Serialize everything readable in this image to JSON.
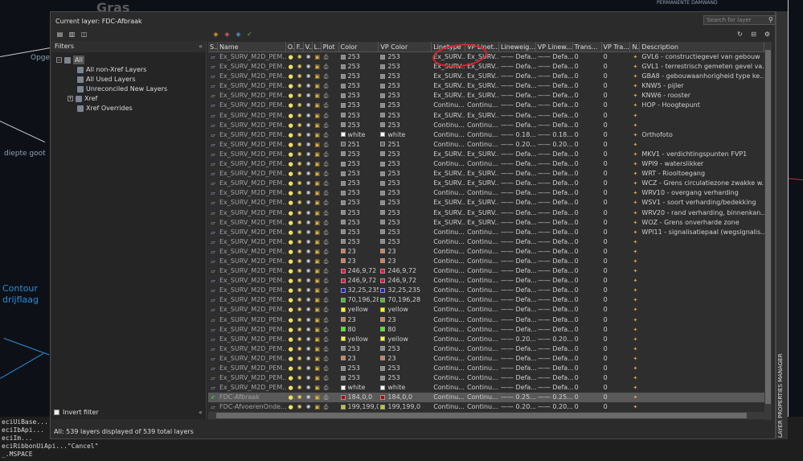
{
  "background": {
    "texts": [
      "Gras",
      "Opgel",
      "diepte goot",
      "Contour",
      "drijflaag",
      "PERMANENTE DAMWAND"
    ]
  },
  "command_line": {
    "lines": [
      "eciUiBase...",
      "eciIbApi...",
      "eciIm...",
      "eciRibbonUiApi...\"Cancel\"",
      "_.MSPACE"
    ]
  },
  "palette": {
    "current_layer": "Current layer: FDC-Afbraak",
    "search_placeholder": "Search for layer",
    "side_title": "LAYER PROPERTIES MANAGER",
    "filters_label": "Filters",
    "filters": [
      {
        "label": "All",
        "selected": true
      },
      {
        "label": "All non-Xref Layers"
      },
      {
        "label": "All Used Layers"
      },
      {
        "label": "Unreconciled New Layers"
      },
      {
        "label": "Xref"
      },
      {
        "label": "Xref Overrides"
      }
    ],
    "invert_filter": "Invert filter",
    "status": "All: 539 layers displayed of 539 total layers",
    "columns": [
      "S..",
      "Name",
      "O..",
      "F..",
      "V..",
      "L..",
      "Plot",
      "Color",
      "VP Color",
      "Linetype",
      "VP Linet...",
      "Lineweig...",
      "VP Linew...",
      "Trans...",
      "VP Tra...",
      "N..",
      "Description"
    ],
    "rows": [
      {
        "name": "Ex_SURV_M2D_PEM...",
        "color": "253",
        "sw": "#8a8a8a",
        "vp": "253",
        "vsw": "#8a8a8a",
        "lt": "Ex_SURV...",
        "vlt": "Ex_SURV...",
        "lw": "—— Defa...",
        "vlw": "—— Defa...",
        "tr": "0",
        "vtr": "0",
        "desc": "GVL6 - constructiegevel van gebouw"
      },
      {
        "name": "Ex_SURV_M2D_PEM...",
        "color": "253",
        "sw": "#8a8a8a",
        "vp": "253",
        "vsw": "#8a8a8a",
        "lt": "Ex_SURV...",
        "vlt": "Ex_SURV...",
        "lw": "—— Defa...",
        "vlw": "—— Defa...",
        "tr": "0",
        "vtr": "0",
        "desc": "GVL1 - terrestrisch gemeten gevel va..."
      },
      {
        "name": "Ex_SURV_M2D_PEM...",
        "color": "253",
        "sw": "#8a8a8a",
        "vp": "253",
        "vsw": "#8a8a8a",
        "lt": "Ex_SURV...",
        "vlt": "Ex_SURV...",
        "lw": "—— Defa...",
        "vlw": "—— Defa...",
        "tr": "0",
        "vtr": "0",
        "desc": "GBA8 - gebouwaanhorigheid type ke..."
      },
      {
        "name": "Ex_SURV_M2D_PEM...",
        "color": "253",
        "sw": "#8a8a8a",
        "vp": "253",
        "vsw": "#8a8a8a",
        "lt": "Ex_SURV...",
        "vlt": "Ex_SURV...",
        "lw": "—— Defa...",
        "vlw": "—— Defa...",
        "tr": "0",
        "vtr": "0",
        "desc": "KNW5 - pijler"
      },
      {
        "name": "Ex_SURV_M2D_PEM...",
        "color": "253",
        "sw": "#8a8a8a",
        "vp": "253",
        "vsw": "#8a8a8a",
        "lt": "Ex_SURV...",
        "vlt": "Ex_SURV...",
        "lw": "—— Defa...",
        "vlw": "—— Defa...",
        "tr": "0",
        "vtr": "0",
        "desc": "KNW6 - rooster"
      },
      {
        "name": "Ex_SURV_M2D_PEM...",
        "color": "253",
        "sw": "#8a8a8a",
        "vp": "253",
        "vsw": "#8a8a8a",
        "lt": "Continu...",
        "vlt": "Continu...",
        "lw": "—— Defa...",
        "vlw": "—— Defa...",
        "tr": "0",
        "vtr": "0",
        "desc": "HOP - Hoogtepunt"
      },
      {
        "name": "Ex_SURV_M2D_PEM...",
        "color": "253",
        "sw": "#8a8a8a",
        "vp": "253",
        "vsw": "#8a8a8a",
        "lt": "Ex_SURV...",
        "vlt": "Ex_SURV...",
        "lw": "—— Defa...",
        "vlw": "—— Defa...",
        "tr": "0",
        "vtr": "0",
        "desc": ""
      },
      {
        "name": "Ex_SURV_M2D_PEM...",
        "color": "253",
        "sw": "#8a8a8a",
        "vp": "253",
        "vsw": "#8a8a8a",
        "lt": "Continu...",
        "vlt": "Continu...",
        "lw": "—— Defa...",
        "vlw": "—— Defa...",
        "tr": "0",
        "vtr": "0",
        "desc": ""
      },
      {
        "name": "Ex_SURV_M2D_PEM...",
        "color": "white",
        "sw": "#ffffff",
        "vp": "white",
        "vsw": "#ffffff",
        "lt": "Continu...",
        "vlt": "Continu...",
        "lw": "—— 0.18...",
        "vlw": "—— 0.18...",
        "tr": "0",
        "vtr": "0",
        "desc": "Orthofoto"
      },
      {
        "name": "Ex_SURV_M2D_PEM...",
        "color": "251",
        "sw": "#5e5e5e",
        "vp": "251",
        "vsw": "#5e5e5e",
        "lt": "Continu...",
        "vlt": "Continu...",
        "lw": "—— 0.20...",
        "vlw": "—— 0.20...",
        "tr": "0",
        "vtr": "0",
        "desc": ""
      },
      {
        "name": "Ex_SURV_M2D_PEM...",
        "color": "253",
        "sw": "#8a8a8a",
        "vp": "253",
        "vsw": "#8a8a8a",
        "lt": "Ex_SURV...",
        "vlt": "Ex_SURV...",
        "lw": "—— Defa...",
        "vlw": "—— Defa...",
        "tr": "0",
        "vtr": "0",
        "desc": "MKV1 - verdichtingspunten FVP1"
      },
      {
        "name": "Ex_SURV_M2D_PEM...",
        "color": "253",
        "sw": "#8a8a8a",
        "vp": "253",
        "vsw": "#8a8a8a",
        "lt": "Continu...",
        "vlt": "Continu...",
        "lw": "—— Defa...",
        "vlw": "—— Defa...",
        "tr": "0",
        "vtr": "0",
        "desc": "WPI9 - waterslikker"
      },
      {
        "name": "Ex_SURV_M2D_PEM...",
        "color": "253",
        "sw": "#8a8a8a",
        "vp": "253",
        "vsw": "#8a8a8a",
        "lt": "Ex_SURV...",
        "vlt": "Ex_SURV...",
        "lw": "—— Defa...",
        "vlw": "—— Defa...",
        "tr": "0",
        "vtr": "0",
        "desc": "WRT - Riooltoegang"
      },
      {
        "name": "Ex_SURV_M2D_PEM...",
        "color": "253",
        "sw": "#8a8a8a",
        "vp": "253",
        "vsw": "#8a8a8a",
        "lt": "Ex_SURV...",
        "vlt": "Ex_SURV...",
        "lw": "—— Defa...",
        "vlw": "—— Defa...",
        "tr": "0",
        "vtr": "0",
        "desc": "WCZ - Grens circulatiezone zwakke w..."
      },
      {
        "name": "Ex_SURV_M2D_PEM...",
        "color": "253",
        "sw": "#8a8a8a",
        "vp": "253",
        "vsw": "#8a8a8a",
        "lt": "Continu...",
        "vlt": "Continu...",
        "lw": "—— Defa...",
        "vlw": "—— Defa...",
        "tr": "0",
        "vtr": "0",
        "desc": "WRV10 - overgang verharding"
      },
      {
        "name": "Ex_SURV_M2D_PEM...",
        "color": "253",
        "sw": "#8a8a8a",
        "vp": "253",
        "vsw": "#8a8a8a",
        "lt": "Ex_SURV...",
        "vlt": "Ex_SURV...",
        "lw": "—— Defa...",
        "vlw": "—— Defa...",
        "tr": "0",
        "vtr": "0",
        "desc": "WSV1 - soort verharding/bedekking"
      },
      {
        "name": "Ex_SURV_M2D_PEM...",
        "color": "253",
        "sw": "#8a8a8a",
        "vp": "253",
        "vsw": "#8a8a8a",
        "lt": "Ex_SURV...",
        "vlt": "Ex_SURV...",
        "lw": "—— Defa...",
        "vlw": "—— Defa...",
        "tr": "0",
        "vtr": "0",
        "desc": "WRV20 - rand verharding, binnenkan..."
      },
      {
        "name": "Ex_SURV_M2D_PEM...",
        "color": "253",
        "sw": "#8a8a8a",
        "vp": "253",
        "vsw": "#8a8a8a",
        "lt": "Ex_SURV...",
        "vlt": "Ex_SURV...",
        "lw": "—— Defa...",
        "vlw": "—— Defa...",
        "tr": "0",
        "vtr": "0",
        "desc": "WOZ - Grens onverharde zone"
      },
      {
        "name": "Ex_SURV_M2D_PEM...",
        "color": "253",
        "sw": "#8a8a8a",
        "vp": "253",
        "vsw": "#8a8a8a",
        "lt": "Continu...",
        "vlt": "Continu...",
        "lw": "—— Defa...",
        "vlw": "—— Defa...",
        "tr": "0",
        "vtr": "0",
        "desc": "WPI11 - signalisatiepaal (wegsignalis..."
      },
      {
        "name": "Ex_SURV_M2D_PEM...",
        "color": "253",
        "sw": "#8a8a8a",
        "vp": "253",
        "vsw": "#8a8a8a",
        "lt": "Continu...",
        "vlt": "Continu...",
        "lw": "—— Defa...",
        "vlw": "—— Defa...",
        "tr": "0",
        "vtr": "0",
        "desc": ""
      },
      {
        "name": "Ex_SURV_M2D_PEM...",
        "color": "23",
        "sw": "#e07a4a",
        "vp": "23",
        "vsw": "#e07a4a",
        "lt": "Continu...",
        "vlt": "Continu...",
        "lw": "—— Defa...",
        "vlw": "—— Defa...",
        "tr": "0",
        "vtr": "0",
        "desc": ""
      },
      {
        "name": "Ex_SURV_M2D_PEM...",
        "color": "23",
        "sw": "#e07a4a",
        "vp": "23",
        "vsw": "#e07a4a",
        "lt": "Continu...",
        "vlt": "Continu...",
        "lw": "—— Defa...",
        "vlw": "—— Defa...",
        "tr": "0",
        "vtr": "0",
        "desc": ""
      },
      {
        "name": "Ex_SURV_M2D_PEM...",
        "color": "246,9,72",
        "sw": "#f60948",
        "vp": "246,9,72",
        "vsw": "#f60948",
        "lt": "Continu...",
        "vlt": "Continu...",
        "lw": "—— Defa...",
        "vlw": "—— Defa...",
        "tr": "0",
        "vtr": "0",
        "desc": ""
      },
      {
        "name": "Ex_SURV_M2D_PEM...",
        "color": "246,9,72",
        "sw": "#f60948",
        "vp": "246,9,72",
        "vsw": "#f60948",
        "lt": "Continu...",
        "vlt": "Continu...",
        "lw": "—— Defa...",
        "vlw": "—— Defa...",
        "tr": "0",
        "vtr": "0",
        "desc": ""
      },
      {
        "name": "Ex_SURV_M2D_PEM...",
        "color": "32,25,235",
        "sw": "#2019eb",
        "vp": "32,25,235",
        "vsw": "#2019eb",
        "lt": "Continu...",
        "vlt": "Continu...",
        "lw": "—— Defa...",
        "vlw": "—— Defa...",
        "tr": "0",
        "vtr": "0",
        "desc": ""
      },
      {
        "name": "Ex_SURV_M2D_PEM...",
        "color": "70,196,28",
        "sw": "#46c41c",
        "vp": "70,196,28",
        "vsw": "#46c41c",
        "lt": "Continu...",
        "vlt": "Continu...",
        "lw": "—— Defa...",
        "vlw": "—— Defa...",
        "tr": "0",
        "vtr": "0",
        "desc": ""
      },
      {
        "name": "Ex_SURV_M2D_PEM...",
        "color": "yellow",
        "sw": "#ffff00",
        "vp": "yellow",
        "vsw": "#ffff00",
        "lt": "Continu...",
        "vlt": "Continu...",
        "lw": "—— Defa...",
        "vlw": "—— Defa...",
        "tr": "0",
        "vtr": "0",
        "desc": ""
      },
      {
        "name": "Ex_SURV_M2D_PEM...",
        "color": "23",
        "sw": "#e07a4a",
        "vp": "23",
        "vsw": "#e07a4a",
        "lt": "Continu...",
        "vlt": "Continu...",
        "lw": "—— Defa...",
        "vlw": "—— Defa...",
        "tr": "0",
        "vtr": "0",
        "desc": ""
      },
      {
        "name": "Ex_SURV_M2D_PEM...",
        "color": "80",
        "sw": "#3fff00",
        "vp": "80",
        "vsw": "#3fff00",
        "lt": "Continu...",
        "vlt": "Continu...",
        "lw": "—— Defa...",
        "vlw": "—— Defa...",
        "tr": "0",
        "vtr": "0",
        "desc": ""
      },
      {
        "name": "Ex_SURV_M2D_PEM...",
        "color": "yellow",
        "sw": "#ffff00",
        "vp": "yellow",
        "vsw": "#ffff00",
        "lt": "Continu...",
        "vlt": "Continu...",
        "lw": "—— 0.20...",
        "vlw": "—— 0.20...",
        "tr": "0",
        "vtr": "0",
        "desc": ""
      },
      {
        "name": "Ex_SURV_M2D_PEM...",
        "color": "253",
        "sw": "#8a8a8a",
        "vp": "253",
        "vsw": "#8a8a8a",
        "lt": "Continu...",
        "vlt": "Continu...",
        "lw": "—— Defa...",
        "vlw": "—— Defa...",
        "tr": "0",
        "vtr": "0",
        "desc": ""
      },
      {
        "name": "Ex_SURV_M2D_PEM...",
        "color": "23",
        "sw": "#e07a4a",
        "vp": "23",
        "vsw": "#e07a4a",
        "lt": "Continu...",
        "vlt": "Continu...",
        "lw": "—— Defa...",
        "vlw": "—— Defa...",
        "tr": "0",
        "vtr": "0",
        "desc": ""
      },
      {
        "name": "Ex_SURV_M2D_PEM...",
        "color": "253",
        "sw": "#8a8a8a",
        "vp": "253",
        "vsw": "#8a8a8a",
        "lt": "Continu...",
        "vlt": "Continu...",
        "lw": "—— Defa...",
        "vlw": "—— Defa...",
        "tr": "0",
        "vtr": "0",
        "desc": ""
      },
      {
        "name": "Ex_SURV_M2D_PEM...",
        "color": "253",
        "sw": "#8a8a8a",
        "vp": "253",
        "vsw": "#8a8a8a",
        "lt": "Continu...",
        "vlt": "Continu...",
        "lw": "—— Defa...",
        "vlw": "—— Defa...",
        "tr": "0",
        "vtr": "0",
        "desc": ""
      },
      {
        "name": "Ex_SURV_M2D_PEM...",
        "color": "white",
        "sw": "#ffffff",
        "vp": "white",
        "vsw": "#ffffff",
        "lt": "Continu...",
        "vlt": "Continu...",
        "lw": "—— Defa...",
        "vlw": "—— Defa...",
        "tr": "0",
        "vtr": "0",
        "desc": ""
      },
      {
        "name": "FDC-Afbraak",
        "color": "184,0,0",
        "sw": "#b80000",
        "vp": "184,0,0",
        "vsw": "#b80000",
        "lt": "Continu...",
        "vlt": "Continu...",
        "lw": "—— 0.25...",
        "vlw": "—— 0.25...",
        "tr": "0",
        "vtr": "0",
        "desc": "",
        "current": true
      },
      {
        "name": "FDC-AfvoerenOnde...",
        "color": "199,199,0",
        "sw": "#c7c700",
        "vp": "199,199,0",
        "vsw": "#c7c700",
        "lt": "Continu...",
        "vlt": "Continu...",
        "lw": "—— 0.20...",
        "vlw": "—— 0.20...",
        "tr": "0",
        "vtr": "0",
        "desc": ""
      }
    ]
  }
}
